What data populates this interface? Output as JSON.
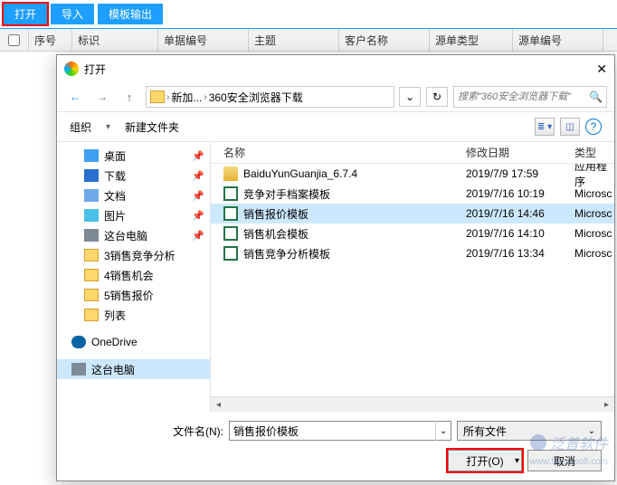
{
  "toolbar": {
    "open": "打开",
    "import": "导入",
    "template_output": "模板输出"
  },
  "table": {
    "seq": "序号",
    "mark": "标识",
    "doc_no": "单据编号",
    "subject": "主题",
    "customer": "客户名称",
    "src_type": "源单类型",
    "src_no": "源单编号"
  },
  "dialog": {
    "title": "打开",
    "breadcrumb": {
      "segment1": "新加...",
      "segment2": "360安全浏览器下载"
    },
    "search_placeholder": "搜索\"360安全浏览器下载\"",
    "organize": "组织",
    "new_folder": "新建文件夹",
    "tree": {
      "desktop": "桌面",
      "downloads": "下载",
      "documents": "文档",
      "pictures": "图片",
      "this_pc": "这台电脑",
      "f1": "3销售竞争分析",
      "f2": "4销售机会",
      "f3": "5销售报价",
      "f4": "列表",
      "onedrive": "OneDrive",
      "this_pc2": "这台电脑"
    },
    "file_headers": {
      "name": "名称",
      "date": "修改日期",
      "type": "类型"
    },
    "files": [
      {
        "name": "BaiduYunGuanjia_6.7.4",
        "date": "2019/7/9 17:59",
        "type": "应用程序"
      },
      {
        "name": "竞争对手档案模板",
        "date": "2019/7/16 10:19",
        "type": "Microsc"
      },
      {
        "name": "销售报价模板",
        "date": "2019/7/16 14:46",
        "type": "Microsc"
      },
      {
        "name": "销售机会模板",
        "date": "2019/7/16 14:10",
        "type": "Microsc"
      },
      {
        "name": "销售竞争分析模板",
        "date": "2019/7/16 13:34",
        "type": "Microsc"
      }
    ],
    "filename_label": "文件名(N):",
    "filename_value": "销售报价模板",
    "filetype": "所有文件",
    "open_btn": "打开(O)",
    "cancel_btn": "取消"
  },
  "watermark": {
    "brand": "泛普软件",
    "url": "www.fanpusoft.com"
  }
}
